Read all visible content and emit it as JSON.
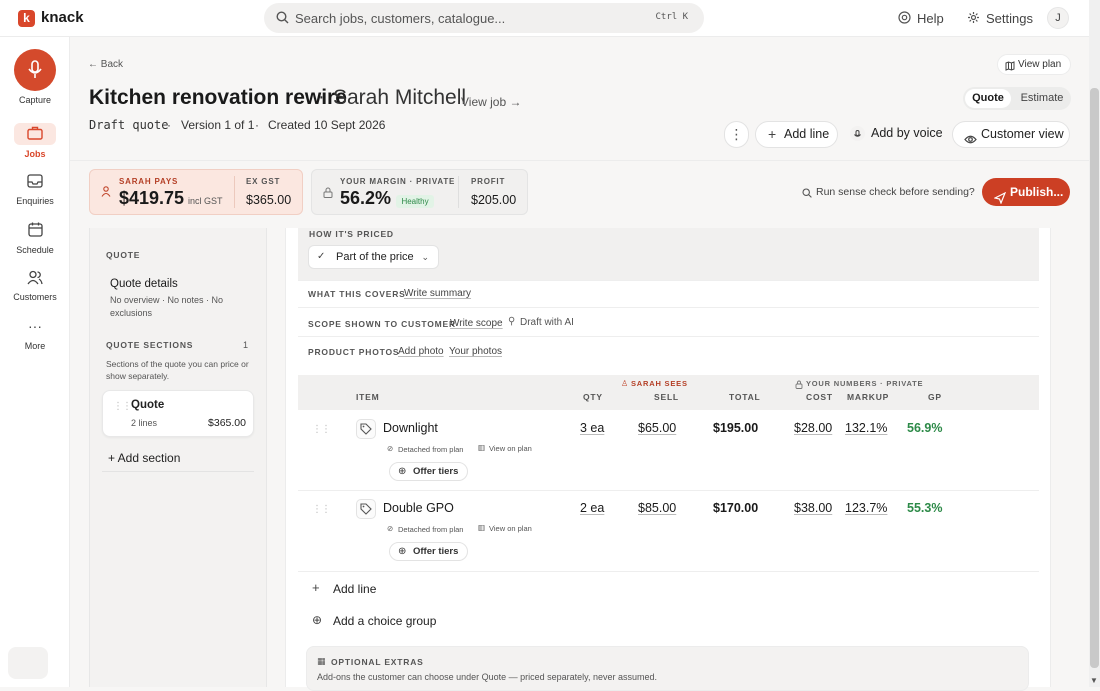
{
  "app": {
    "name": "knack",
    "logo_letter": "k"
  },
  "search": {
    "placeholder": "Search jobs, customers, catalogue...",
    "shortcut": "Ctrl K"
  },
  "topnav": {
    "help": "Help",
    "settings": "Settings",
    "avatar": "J"
  },
  "sidebar": {
    "capture": "Capture",
    "items": [
      {
        "label": "Jobs",
        "icon": "briefcase-icon",
        "active": true
      },
      {
        "label": "Enquiries",
        "icon": "inbox-icon"
      },
      {
        "label": "Schedule",
        "icon": "calendar-icon"
      },
      {
        "label": "Customers",
        "icon": "users-icon"
      },
      {
        "label": "More",
        "icon": "more-dots-icon"
      }
    ]
  },
  "header": {
    "back": "← Back",
    "view_plan": "View plan",
    "title": "Kitchen renovation rewire",
    "separator": "·",
    "client": "Sarah Mitchell",
    "view_job": "View job →",
    "tabs": [
      "Quote",
      "Estimate"
    ],
    "status": "Draft quote",
    "version": "Version 1 of 1",
    "created": "Created 10 Sept 2026",
    "dot": "·"
  },
  "actions": {
    "add_line": "Add line",
    "add_by_voice": "Add by voice",
    "customer_view": "Customer view"
  },
  "summary": {
    "sarah_pays_label": "SARAH PAYS",
    "sarah_pays": "$419.75",
    "incl_gst": "incl GST",
    "ex_gst_label": "EX GST",
    "ex_gst": "$365.00",
    "margin_label": "YOUR MARGIN · PRIVATE",
    "margin": "56.2%",
    "margin_badge": "Healthy",
    "profit_label": "PROFIT",
    "profit": "$205.00",
    "sense_check": "Run sense check before sending?",
    "publish": "Publish..."
  },
  "left_panel": {
    "heading": "QUOTE",
    "details_title": "Quote details",
    "details_text": "No overview · No notes · No exclusions",
    "sections_label": "QUOTE SECTIONS",
    "sections_count": "1",
    "sections_help": "Sections of the quote you can price or show separately.",
    "section": {
      "name": "Quote",
      "lines": "2 lines",
      "total": "$365.00"
    },
    "add_section": "+ Add section"
  },
  "editor": {
    "how_priced_label": "HOW IT'S PRICED",
    "how_priced_value": "Part of the price",
    "covers_label": "WHAT THIS COVERS",
    "covers_link": "Write summary",
    "scope_label": "SCOPE SHOWN TO CUSTOMER",
    "scope_link": "Write scope",
    "scope_ai": "Draft with AI",
    "photos_label": "PRODUCT PHOTOS",
    "add_photo": "Add photo",
    "your_photos": "Your photos",
    "table": {
      "sarah_sees": "SARAH SEES",
      "your_numbers": "YOUR NUMBERS · PRIVATE",
      "headers": {
        "item": "ITEM",
        "qty": "QTY",
        "sell": "SELL",
        "total": "TOTAL",
        "cost": "COST",
        "markup": "MARKUP",
        "gp": "GP"
      },
      "rows": [
        {
          "item": "Downlight",
          "qty": "3 ea",
          "sell": "$65.00",
          "total": "$195.00",
          "cost": "$28.00",
          "markup": "132.1%",
          "gp": "56.9%",
          "detached": "Detached from plan",
          "view_on_plan": "View on plan",
          "offer_tiers": "Offer tiers"
        },
        {
          "item": "Double GPO",
          "qty": "2 ea",
          "sell": "$85.00",
          "total": "$170.00",
          "cost": "$38.00",
          "markup": "123.7%",
          "gp": "55.3%",
          "detached": "Detached from plan",
          "view_on_plan": "View on plan",
          "offer_tiers": "Offer tiers"
        }
      ]
    },
    "add_line": "Add line",
    "add_choice_group": "Add a choice group",
    "extras_label": "OPTIONAL EXTRAS",
    "extras_text": "Add-ons the customer can choose under Quote — priced separately, never assumed."
  },
  "colors": {
    "accent": "#cc3f24",
    "healthy": "#2d8a48",
    "sarah": "#d9472b"
  }
}
